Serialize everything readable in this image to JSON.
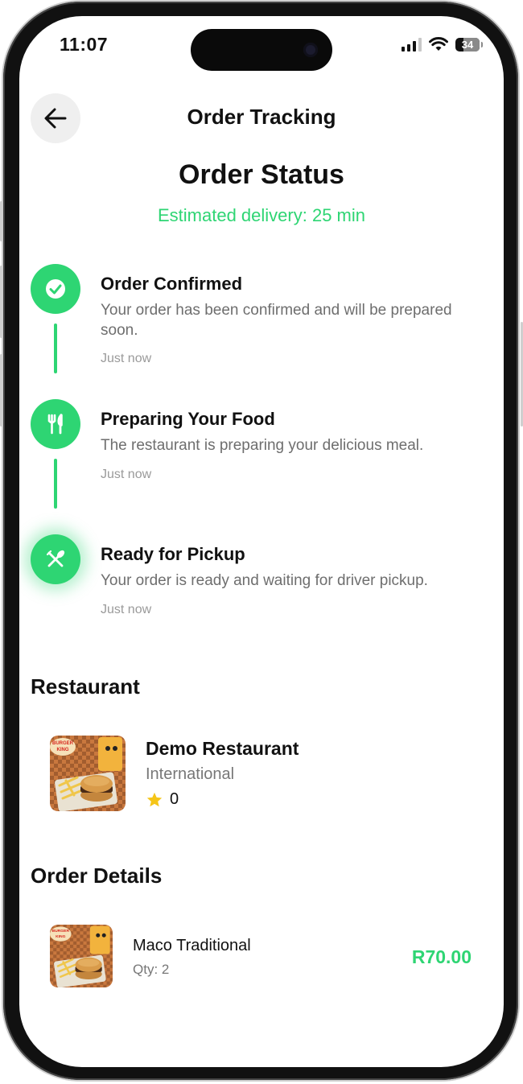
{
  "status_bar": {
    "time": "11:07",
    "battery": "34"
  },
  "header": {
    "title": "Order Tracking"
  },
  "order_status": {
    "title": "Order Status",
    "eta": "Estimated delivery: 25 min"
  },
  "steps": [
    {
      "title": "Order Confirmed",
      "description": "Your order has been confirmed and will be prepared soon.",
      "time": "Just now",
      "icon": "check-icon"
    },
    {
      "title": "Preparing Your Food",
      "description": "The restaurant is preparing your delicious meal.",
      "time": "Just now",
      "icon": "fork-knife-icon"
    },
    {
      "title": "Ready for Pickup",
      "description": "Your order is ready and waiting for driver pickup.",
      "time": "Just now",
      "icon": "utensils-crossed-icon"
    }
  ],
  "restaurant": {
    "section_title": "Restaurant",
    "name": "Demo Restaurant",
    "cuisine": "International",
    "rating": "0",
    "logo_text": "BURGER KING"
  },
  "order_details": {
    "section_title": "Order Details",
    "items": [
      {
        "name": "Maco Traditional",
        "qty": "Qty: 2",
        "price": "R70.00"
      }
    ]
  },
  "colors": {
    "accent": "#2ed573",
    "star": "#f5c518"
  }
}
